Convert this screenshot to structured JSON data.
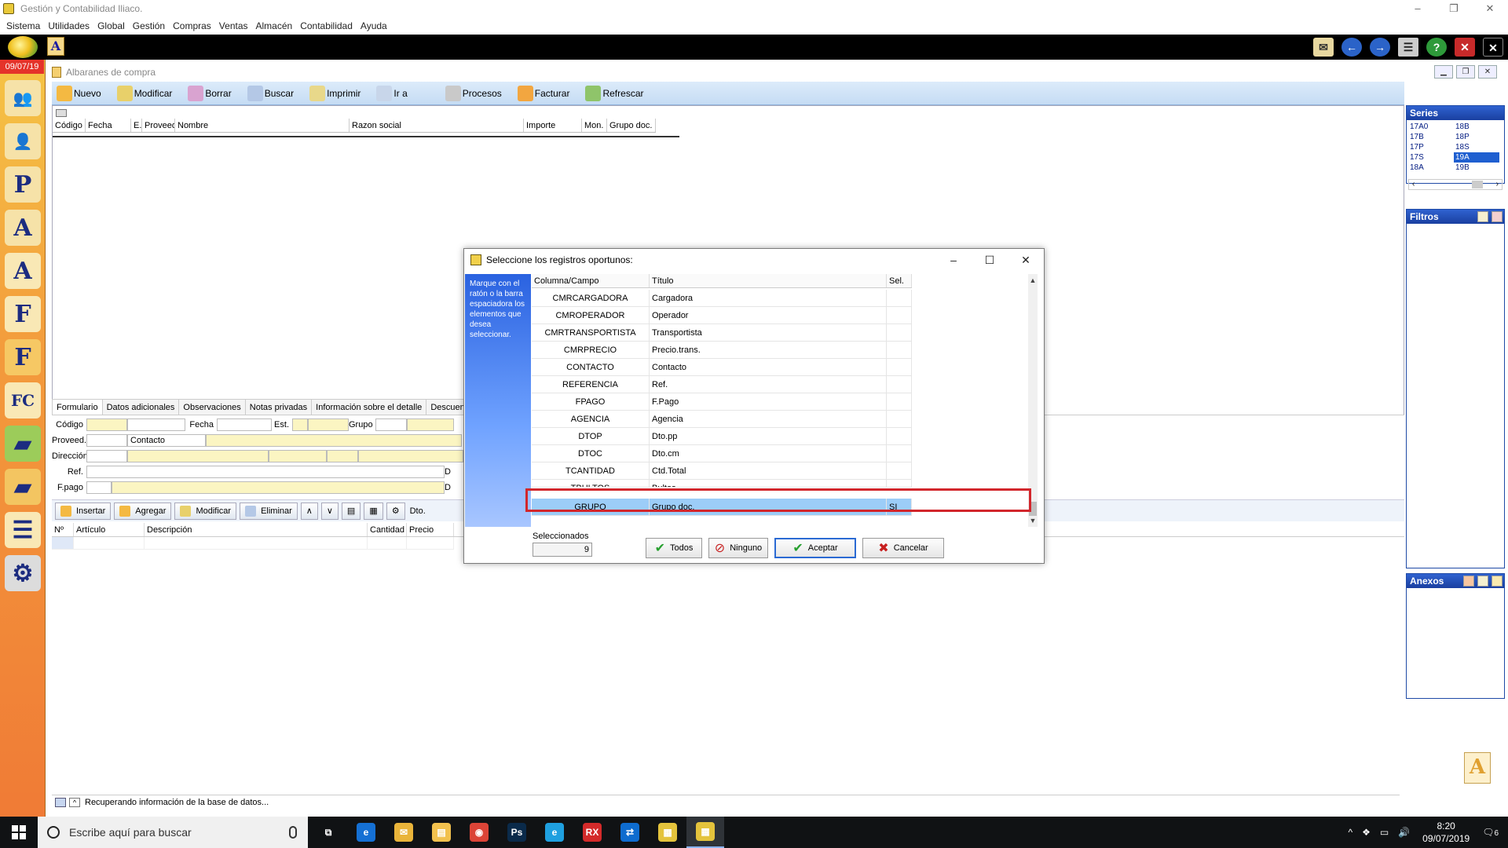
{
  "window": {
    "title": "Gestión y Contabilidad Iliaco.",
    "controls": [
      "–",
      "❐",
      "✕"
    ]
  },
  "menu": [
    "Sistema",
    "Utilidades",
    "Global",
    "Gestión",
    "Compras",
    "Ventas",
    "Almacén",
    "Contabilidad",
    "Ayuda"
  ],
  "launcher": {
    "date": "09/07/19",
    "items": [
      {
        "name": "clientes-icon",
        "glyph": "👥",
        "color": "#f6e2a8"
      },
      {
        "name": "usuario-icon",
        "glyph": "👤",
        "color": "#f6e2a8"
      },
      {
        "name": "proveedor-icon",
        "glyph": "P",
        "color": "#f6e2a8"
      },
      {
        "name": "acreedor-icon",
        "glyph": "A",
        "color": "#f6e2a8"
      },
      {
        "name": "albaran-icon",
        "glyph": "A",
        "color": "#f9e8b5"
      },
      {
        "name": "factura-icon",
        "glyph": "F",
        "color": "#f9e8b5"
      },
      {
        "name": "factura-venta-icon",
        "glyph": "F",
        "color": "#f6c864"
      },
      {
        "name": "factura-compra-icon",
        "glyph": "FC",
        "color": "#f9e8b5"
      },
      {
        "name": "almacen-icon",
        "glyph": "▰",
        "color": "#9ccc5a"
      },
      {
        "name": "caja-icon",
        "glyph": "▰",
        "color": "#f3c561"
      },
      {
        "name": "listado-icon",
        "glyph": "☰",
        "color": "#f9e8b5"
      },
      {
        "name": "herramientas-icon",
        "glyph": "⚙",
        "color": "#dcdcdc"
      }
    ]
  },
  "child": {
    "title": "Albaranes de compra",
    "toolbar": [
      {
        "label": "Nuevo",
        "icon": "nuevo-icon",
        "color": "#f4b942"
      },
      {
        "label": "Modificar",
        "icon": "modificar-icon",
        "color": "#e8d06a"
      },
      {
        "label": "Borrar",
        "icon": "borrar-icon",
        "color": "#d9a3d0"
      },
      {
        "label": "Buscar",
        "icon": "buscar-icon",
        "color": "#b4c8e6"
      },
      {
        "label": "Imprimir",
        "icon": "imprimir-icon",
        "color": "#e8d88a"
      },
      {
        "label": "Ir a",
        "icon": "ir-a-icon",
        "color": "#c8d6ea"
      },
      {
        "label": "Procesos",
        "icon": "procesos-icon",
        "color": "#c9c9c9"
      },
      {
        "label": "Facturar",
        "icon": "facturar-icon",
        "color": "#f2a640"
      },
      {
        "label": "Refrescar",
        "icon": "refrescar-icon",
        "color": "#8fc46a"
      }
    ],
    "grid_columns": [
      {
        "label": "Código",
        "w": 42
      },
      {
        "label": "Fecha",
        "w": 58
      },
      {
        "label": "E.",
        "w": 14
      },
      {
        "label": "Proveed.",
        "w": 42
      },
      {
        "label": "Nombre",
        "w": 222
      },
      {
        "label": "Razon social",
        "w": 222
      },
      {
        "label": "Importe",
        "w": 74
      },
      {
        "label": "Mon.",
        "w": 32
      },
      {
        "label": "Grupo doc.",
        "w": 62
      }
    ]
  },
  "right_panel": {
    "series_title": "Series",
    "series": [
      {
        "v": "17A0",
        "sel": false
      },
      {
        "v": "18B",
        "sel": false
      },
      {
        "v": "17B",
        "sel": false
      },
      {
        "v": "18P",
        "sel": false
      },
      {
        "v": "17P",
        "sel": false
      },
      {
        "v": "18S",
        "sel": false
      },
      {
        "v": "17S",
        "sel": false
      },
      {
        "v": "19A",
        "sel": true
      },
      {
        "v": "18A",
        "sel": false
      },
      {
        "v": "19B",
        "sel": false
      }
    ],
    "filters_title": "Filtros",
    "annexes_title": "Anexos"
  },
  "form": {
    "tabs": [
      "Formulario",
      "Datos adicionales",
      "Observaciones",
      "Notas privadas",
      "Información sobre el detalle",
      "Descuentos"
    ],
    "labels": {
      "codigo": "Código",
      "fecha": "Fecha",
      "est": "Est.",
      "grupo": "Grupo",
      "proveed": "Proveed.",
      "contacto": "Contacto",
      "direccion": "Dirección",
      "ref": "Ref.",
      "fpago": "F.pago",
      "d": "D"
    },
    "line_buttons": [
      {
        "label": "Insertar",
        "icon": "insertar-icon",
        "color": "#f4b942"
      },
      {
        "label": "Agregar",
        "icon": "agregar-icon",
        "color": "#f4b942"
      },
      {
        "label": "Modificar",
        "icon": "modificar-linea-icon",
        "color": "#e8d06a"
      },
      {
        "label": "Eliminar",
        "icon": "eliminar-icon",
        "color": "#b4c8e6"
      }
    ],
    "dto_label": "Dto.",
    "line_columns": [
      {
        "label": "Nº",
        "w": 28
      },
      {
        "label": "Artículo",
        "w": 90
      },
      {
        "label": "Descripción",
        "w": 284
      },
      {
        "label": "Cantidad",
        "w": 50
      },
      {
        "label": "Precio",
        "w": 60
      }
    ]
  },
  "status": {
    "text": "Recuperando información de la base de datos..."
  },
  "dialog": {
    "title": "Seleccione los registros oportunos:",
    "hint": "Marque con el ratón o la barra espaciadora los elementos que desea seleccionar.",
    "columns": [
      "Columna/Campo",
      "Título",
      "Sel."
    ],
    "rows": [
      {
        "campo": "CMRCARGADORA",
        "titulo": "Cargadora",
        "sel": ""
      },
      {
        "campo": "CMROPERADOR",
        "titulo": "Operador",
        "sel": ""
      },
      {
        "campo": "CMRTRANSPORTISTA",
        "titulo": "Transportista",
        "sel": ""
      },
      {
        "campo": "CMRPRECIO",
        "titulo": "Precio.trans.",
        "sel": ""
      },
      {
        "campo": "CONTACTO",
        "titulo": "Contacto",
        "sel": ""
      },
      {
        "campo": "REFERENCIA",
        "titulo": "Ref.",
        "sel": ""
      },
      {
        "campo": "FPAGO",
        "titulo": "F.Pago",
        "sel": ""
      },
      {
        "campo": "AGENCIA",
        "titulo": "Agencia",
        "sel": ""
      },
      {
        "campo": "DTOP",
        "titulo": "Dto.pp",
        "sel": ""
      },
      {
        "campo": "DTOC",
        "titulo": "Dto.cm",
        "sel": ""
      },
      {
        "campo": "TCANTIDAD",
        "titulo": "Ctd.Total",
        "sel": ""
      },
      {
        "campo": "TBULTOS",
        "titulo": "Bultos",
        "sel": ""
      }
    ],
    "highlighted_row": {
      "campo": "GRUPO",
      "titulo": "Grupo doc.",
      "sel": "SI"
    },
    "selected_label": "Seleccionados",
    "selected_count": "9",
    "buttons": {
      "todos": "Todos",
      "ninguno": "Ninguno",
      "aceptar": "Aceptar",
      "cancelar": "Cancelar"
    }
  },
  "taskbar": {
    "search_placeholder": "Escribe aquí para buscar",
    "apps": [
      {
        "name": "task-view-icon",
        "label": "⧉",
        "color": "#101214",
        "active": false
      },
      {
        "name": "edge-icon",
        "label": "e",
        "color": "#1570d4",
        "active": false
      },
      {
        "name": "mail-folder-icon",
        "label": "✉",
        "color": "#e9b43a",
        "active": false
      },
      {
        "name": "file-explorer-icon",
        "label": "▤",
        "color": "#f2c14e",
        "active": false
      },
      {
        "name": "chrome-icon",
        "label": "◉",
        "color": "#db4437",
        "active": false
      },
      {
        "name": "photoshop-icon",
        "label": "Ps",
        "color": "#0a2a4a",
        "active": false
      },
      {
        "name": "ie-icon",
        "label": "e",
        "color": "#1fa0e0",
        "active": false
      },
      {
        "name": "rx-app-icon",
        "label": "RX",
        "color": "#d42a2a",
        "active": false
      },
      {
        "name": "teamviewer-icon",
        "label": "⇄",
        "color": "#0e6ccf",
        "active": false
      },
      {
        "name": "gestion-app-icon",
        "label": "▦",
        "color": "#e4c33c",
        "active": false
      },
      {
        "name": "gestion-app-active-icon",
        "label": "▦",
        "color": "#e4c33c",
        "active": true
      }
    ],
    "time": "8:20",
    "date": "09/07/2019",
    "notifications": "6"
  }
}
